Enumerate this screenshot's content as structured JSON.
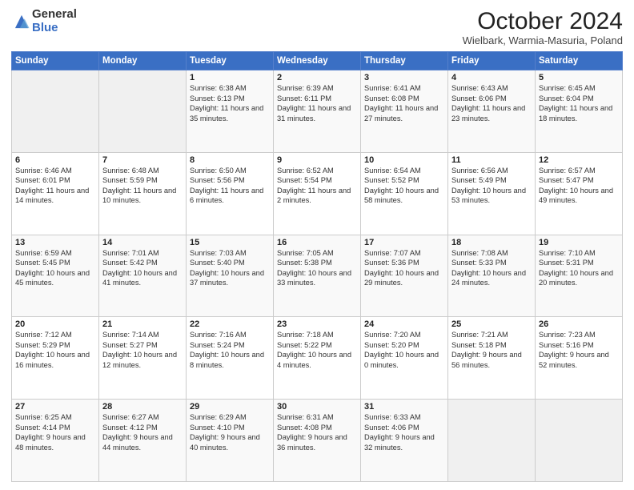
{
  "logo": {
    "general": "General",
    "blue": "Blue"
  },
  "title": "October 2024",
  "subtitle": "Wielbark, Warmia-Masuria, Poland",
  "headers": [
    "Sunday",
    "Monday",
    "Tuesday",
    "Wednesday",
    "Thursday",
    "Friday",
    "Saturday"
  ],
  "weeks": [
    [
      {
        "num": "",
        "info": ""
      },
      {
        "num": "",
        "info": ""
      },
      {
        "num": "1",
        "info": "Sunrise: 6:38 AM\nSunset: 6:13 PM\nDaylight: 11 hours and 35 minutes."
      },
      {
        "num": "2",
        "info": "Sunrise: 6:39 AM\nSunset: 6:11 PM\nDaylight: 11 hours and 31 minutes."
      },
      {
        "num": "3",
        "info": "Sunrise: 6:41 AM\nSunset: 6:08 PM\nDaylight: 11 hours and 27 minutes."
      },
      {
        "num": "4",
        "info": "Sunrise: 6:43 AM\nSunset: 6:06 PM\nDaylight: 11 hours and 23 minutes."
      },
      {
        "num": "5",
        "info": "Sunrise: 6:45 AM\nSunset: 6:04 PM\nDaylight: 11 hours and 18 minutes."
      }
    ],
    [
      {
        "num": "6",
        "info": "Sunrise: 6:46 AM\nSunset: 6:01 PM\nDaylight: 11 hours and 14 minutes."
      },
      {
        "num": "7",
        "info": "Sunrise: 6:48 AM\nSunset: 5:59 PM\nDaylight: 11 hours and 10 minutes."
      },
      {
        "num": "8",
        "info": "Sunrise: 6:50 AM\nSunset: 5:56 PM\nDaylight: 11 hours and 6 minutes."
      },
      {
        "num": "9",
        "info": "Sunrise: 6:52 AM\nSunset: 5:54 PM\nDaylight: 11 hours and 2 minutes."
      },
      {
        "num": "10",
        "info": "Sunrise: 6:54 AM\nSunset: 5:52 PM\nDaylight: 10 hours and 58 minutes."
      },
      {
        "num": "11",
        "info": "Sunrise: 6:56 AM\nSunset: 5:49 PM\nDaylight: 10 hours and 53 minutes."
      },
      {
        "num": "12",
        "info": "Sunrise: 6:57 AM\nSunset: 5:47 PM\nDaylight: 10 hours and 49 minutes."
      }
    ],
    [
      {
        "num": "13",
        "info": "Sunrise: 6:59 AM\nSunset: 5:45 PM\nDaylight: 10 hours and 45 minutes."
      },
      {
        "num": "14",
        "info": "Sunrise: 7:01 AM\nSunset: 5:42 PM\nDaylight: 10 hours and 41 minutes."
      },
      {
        "num": "15",
        "info": "Sunrise: 7:03 AM\nSunset: 5:40 PM\nDaylight: 10 hours and 37 minutes."
      },
      {
        "num": "16",
        "info": "Sunrise: 7:05 AM\nSunset: 5:38 PM\nDaylight: 10 hours and 33 minutes."
      },
      {
        "num": "17",
        "info": "Sunrise: 7:07 AM\nSunset: 5:36 PM\nDaylight: 10 hours and 29 minutes."
      },
      {
        "num": "18",
        "info": "Sunrise: 7:08 AM\nSunset: 5:33 PM\nDaylight: 10 hours and 24 minutes."
      },
      {
        "num": "19",
        "info": "Sunrise: 7:10 AM\nSunset: 5:31 PM\nDaylight: 10 hours and 20 minutes."
      }
    ],
    [
      {
        "num": "20",
        "info": "Sunrise: 7:12 AM\nSunset: 5:29 PM\nDaylight: 10 hours and 16 minutes."
      },
      {
        "num": "21",
        "info": "Sunrise: 7:14 AM\nSunset: 5:27 PM\nDaylight: 10 hours and 12 minutes."
      },
      {
        "num": "22",
        "info": "Sunrise: 7:16 AM\nSunset: 5:24 PM\nDaylight: 10 hours and 8 minutes."
      },
      {
        "num": "23",
        "info": "Sunrise: 7:18 AM\nSunset: 5:22 PM\nDaylight: 10 hours and 4 minutes."
      },
      {
        "num": "24",
        "info": "Sunrise: 7:20 AM\nSunset: 5:20 PM\nDaylight: 10 hours and 0 minutes."
      },
      {
        "num": "25",
        "info": "Sunrise: 7:21 AM\nSunset: 5:18 PM\nDaylight: 9 hours and 56 minutes."
      },
      {
        "num": "26",
        "info": "Sunrise: 7:23 AM\nSunset: 5:16 PM\nDaylight: 9 hours and 52 minutes."
      }
    ],
    [
      {
        "num": "27",
        "info": "Sunrise: 6:25 AM\nSunset: 4:14 PM\nDaylight: 9 hours and 48 minutes."
      },
      {
        "num": "28",
        "info": "Sunrise: 6:27 AM\nSunset: 4:12 PM\nDaylight: 9 hours and 44 minutes."
      },
      {
        "num": "29",
        "info": "Sunrise: 6:29 AM\nSunset: 4:10 PM\nDaylight: 9 hours and 40 minutes."
      },
      {
        "num": "30",
        "info": "Sunrise: 6:31 AM\nSunset: 4:08 PM\nDaylight: 9 hours and 36 minutes."
      },
      {
        "num": "31",
        "info": "Sunrise: 6:33 AM\nSunset: 4:06 PM\nDaylight: 9 hours and 32 minutes."
      },
      {
        "num": "",
        "info": ""
      },
      {
        "num": "",
        "info": ""
      }
    ]
  ]
}
